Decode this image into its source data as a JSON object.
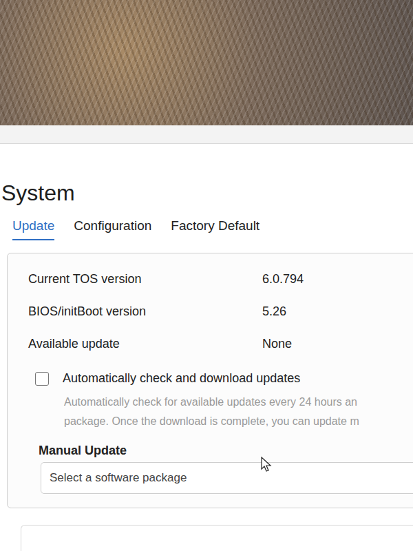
{
  "photo": {
    "kind": "fur-photo"
  },
  "page": {
    "title": "System"
  },
  "tabs": [
    {
      "label": "Update",
      "selected": true
    },
    {
      "label": "Configuration",
      "selected": false
    },
    {
      "label": "Factory Default",
      "selected": false
    }
  ],
  "info_rows": [
    {
      "label": "Current TOS version",
      "value": "6.0.794"
    },
    {
      "label": "BIOS/initBoot version",
      "value": "5.26"
    },
    {
      "label": "Available update",
      "value": "None"
    }
  ],
  "auto_update": {
    "label": "Automatically check and download updates",
    "checked": false,
    "description": [
      "Automatically check for available updates every 24 hours an",
      "package. Once the download is complete, you can update m"
    ]
  },
  "manual_update": {
    "label": "Manual Update",
    "placeholder": "Select a software package"
  }
}
